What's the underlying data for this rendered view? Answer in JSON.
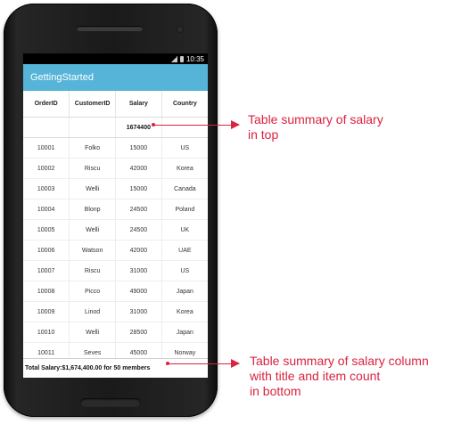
{
  "status_bar": {
    "time": "10:35"
  },
  "app_bar": {
    "title": "GettingStarted"
  },
  "grid": {
    "columns": [
      "OrderID",
      "CustomerID",
      "Salary",
      "Country"
    ],
    "top_summary": "1674400",
    "rows": [
      [
        "10001",
        "Folko",
        "15000",
        "US"
      ],
      [
        "10002",
        "Riscu",
        "42000",
        "Korea"
      ],
      [
        "10003",
        "Welli",
        "15000",
        "Canada"
      ],
      [
        "10004",
        "Blonp",
        "24500",
        "Poland"
      ],
      [
        "10005",
        "Welli",
        "24500",
        "UK"
      ],
      [
        "10006",
        "Watson",
        "42000",
        "UAE"
      ],
      [
        "10007",
        "Riscu",
        "31000",
        "US"
      ],
      [
        "10008",
        "Picco",
        "49000",
        "Japan"
      ],
      [
        "10009",
        "Linod",
        "31000",
        "Korea"
      ],
      [
        "10010",
        "Welli",
        "28500",
        "Japan"
      ],
      [
        "10011",
        "Seves",
        "45000",
        "Norway"
      ]
    ],
    "bottom_summary": "Total Salary:$1,674,400.00 for 50 members"
  },
  "annotations": {
    "top": [
      "Table summary of salary",
      "in top"
    ],
    "bottom": [
      "Table summary of salary column",
      "with title and item count",
      "in bottom"
    ]
  },
  "colors": {
    "app_bar": "#56b4d8",
    "annotation": "#d9233f",
    "phone_body": "#1a1a1a"
  }
}
